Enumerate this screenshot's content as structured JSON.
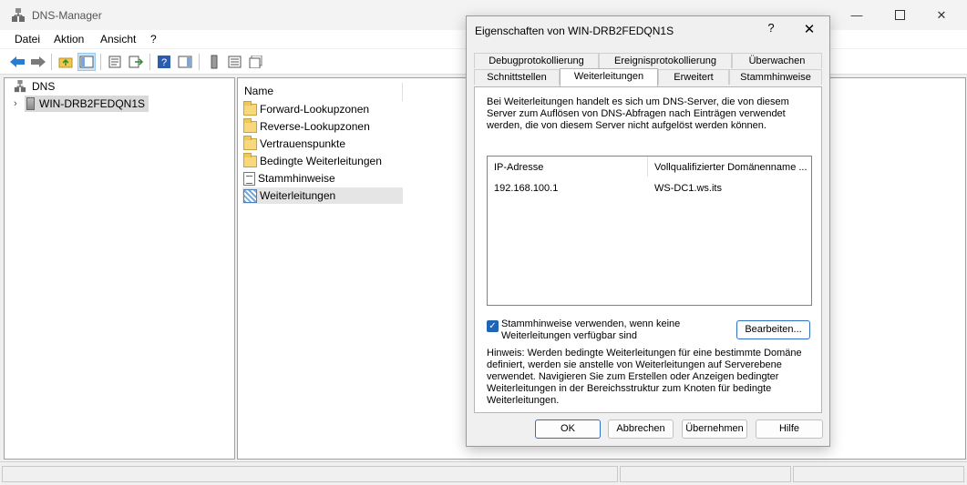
{
  "window": {
    "title": "DNS-Manager"
  },
  "menu": {
    "items": [
      "Datei",
      "Aktion",
      "Ansicht",
      "?"
    ]
  },
  "tree": {
    "root_label": "DNS",
    "server_label": "WIN-DRB2FEDQN1S"
  },
  "list": {
    "column_header": "Name",
    "items": [
      {
        "label": "Forward-Lookupzonen",
        "icon": "folder-icon"
      },
      {
        "label": "Reverse-Lookupzonen",
        "icon": "folder-icon"
      },
      {
        "label": "Vertrauenspunkte",
        "icon": "folder-icon"
      },
      {
        "label": "Bedingte Weiterleitungen",
        "icon": "folder-icon"
      },
      {
        "label": "Stammhinweise",
        "icon": "root-hints-icon"
      },
      {
        "label": "Weiterleitungen",
        "icon": "forwarders-icon"
      }
    ]
  },
  "dialog": {
    "title": "Eigenschaften von WIN-DRB2FEDQN1S",
    "help": "?",
    "close": "✕",
    "tabs_row1": [
      "Debugprotokollierung",
      "Ereignisprotokollierung",
      "Überwachen"
    ],
    "tabs_row2": [
      "Schnittstellen",
      "Weiterleitungen",
      "Erweitert",
      "Stammhinweise"
    ],
    "active_tab": "Weiterleitungen",
    "description": "Bei Weiterleitungen handelt es sich um DNS-Server, die von diesem Server zum Auflösen von DNS-Abfragen nach Einträgen verwendet werden, die von diesem Server nicht aufgelöst werden können.",
    "table": {
      "col_ip": "IP-Adresse",
      "col_fqdn": "Vollqualifizierter Domänenname ...",
      "rows": [
        {
          "ip": "192.168.100.1",
          "fqdn": "WS-DC1.ws.its"
        }
      ]
    },
    "checkbox_label": "Stammhinweise verwenden, wenn keine Weiterleitungen verfügbar sind",
    "checkbox_checked": true,
    "edit_button": "Bearbeiten...",
    "hint": "Hinweis: Werden bedingte Weiterleitungen für eine bestimmte Domäne definiert, werden sie anstelle von Weiterleitungen auf Serverebene verwendet. Navigieren Sie zum Erstellen oder Anzeigen bedingter Weiterleitungen in der Bereichsstruktur zum Knoten für bedingte Weiterleitungen.",
    "buttons": {
      "ok": "OK",
      "cancel": "Abbrechen",
      "apply": "Übernehmen",
      "help": "Hilfe"
    }
  },
  "colors": {
    "accent": "#1f65b5",
    "window_bg": "#f0f0f0"
  }
}
